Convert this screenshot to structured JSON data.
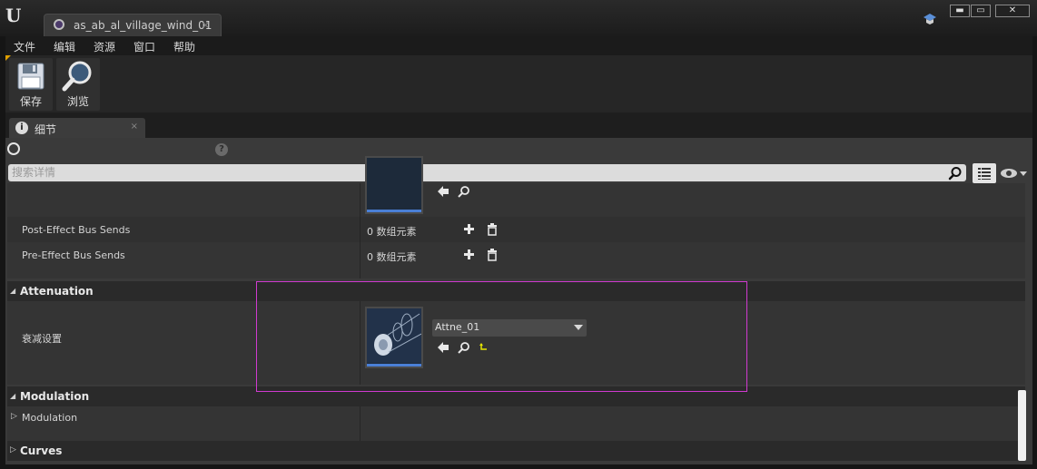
{
  "window": {
    "tab_title": "as_ab_al_village_wind_01",
    "tab_close": "×",
    "min": "▬",
    "max": "▭",
    "close": "✕"
  },
  "menu": [
    "文件",
    "编辑",
    "资源",
    "窗口",
    "帮助"
  ],
  "toolbar": {
    "save_label": "保存",
    "browse_label": "浏览"
  },
  "details_tab": {
    "icon": "i",
    "label": "细节",
    "close": "×"
  },
  "search": {
    "placeholder": "搜索详情",
    "help_glyph": "?"
  },
  "rows": {
    "post_effect": {
      "label": "Post-Effect Bus Sends",
      "value": "0 数组元素"
    },
    "pre_effect": {
      "label": "Pre-Effect Bus Sends",
      "value": "0 数组元素"
    }
  },
  "attenuation": {
    "category": "Attenuation",
    "label": "衰减设置",
    "asset": "Attne_01"
  },
  "modulation": {
    "category": "Modulation",
    "item": "Modulation"
  },
  "curves": {
    "category": "Curves"
  },
  "icons": {
    "logo": "unreal-logo-icon",
    "asset": "sound-cue-icon",
    "save": "floppy-disk-icon",
    "browse": "magnifier-icon",
    "lock": "lock-circle-icon",
    "help": "help-icon",
    "search": "search-icon",
    "view": "view-options-icon",
    "eye": "eye-icon",
    "use": "arrow-left-icon",
    "browse_asset": "browse-icon",
    "reset": "reset-icon",
    "add": "plus-icon",
    "delete": "trash-icon"
  },
  "colors": {
    "highlight": "#d03ad0",
    "accent_bar": "#4a7fd6"
  }
}
